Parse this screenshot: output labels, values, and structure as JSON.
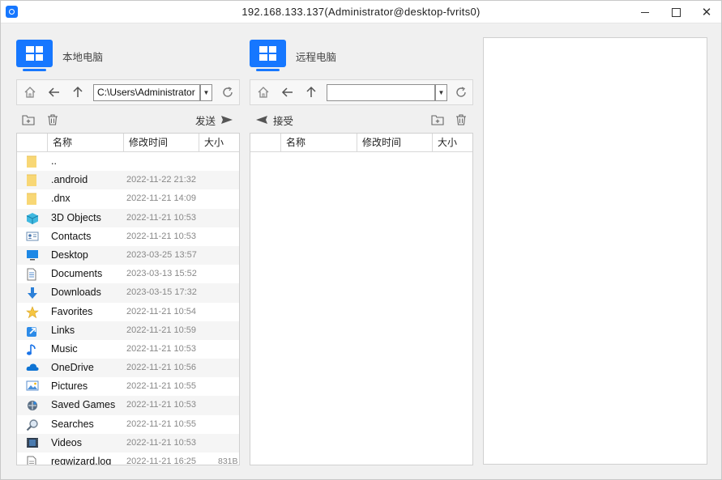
{
  "window": {
    "title": "192.168.133.137(Administrator@desktop-fvrits0)"
  },
  "local": {
    "label": "本地电脑",
    "path": "C:\\Users\\Administrator",
    "send_label": "发送",
    "columns": [
      "名称",
      "修改时间",
      "大小"
    ],
    "files": [
      {
        "name": "..",
        "date": "",
        "size": "",
        "icon": "folder-icon"
      },
      {
        "name": ".android",
        "date": "2022-11-22 21:32",
        "size": "",
        "icon": "folder-icon"
      },
      {
        "name": ".dnx",
        "date": "2022-11-21 14:09",
        "size": "",
        "icon": "folder-icon"
      },
      {
        "name": "3D Objects",
        "date": "2022-11-21 10:53",
        "size": "",
        "icon": "3d-objects-icon"
      },
      {
        "name": "Contacts",
        "date": "2022-11-21 10:53",
        "size": "",
        "icon": "contacts-icon"
      },
      {
        "name": "Desktop",
        "date": "2023-03-25 13:57",
        "size": "",
        "icon": "desktop-icon"
      },
      {
        "name": "Documents",
        "date": "2023-03-13 15:52",
        "size": "",
        "icon": "documents-icon"
      },
      {
        "name": "Downloads",
        "date": "2023-03-15 17:32",
        "size": "",
        "icon": "downloads-icon"
      },
      {
        "name": "Favorites",
        "date": "2022-11-21 10:54",
        "size": "",
        "icon": "favorites-icon"
      },
      {
        "name": "Links",
        "date": "2022-11-21 10:59",
        "size": "",
        "icon": "links-icon"
      },
      {
        "name": "Music",
        "date": "2022-11-21 10:53",
        "size": "",
        "icon": "music-icon"
      },
      {
        "name": "OneDrive",
        "date": "2022-11-21 10:56",
        "size": "",
        "icon": "onedrive-icon"
      },
      {
        "name": "Pictures",
        "date": "2022-11-21 10:55",
        "size": "",
        "icon": "pictures-icon"
      },
      {
        "name": "Saved Games",
        "date": "2022-11-21 10:53",
        "size": "",
        "icon": "saved-games-icon"
      },
      {
        "name": "Searches",
        "date": "2022-11-21 10:55",
        "size": "",
        "icon": "searches-icon"
      },
      {
        "name": "Videos",
        "date": "2022-11-21 10:53",
        "size": "",
        "icon": "videos-icon"
      },
      {
        "name": "regwizard.log",
        "date": "2022-11-21 16:25",
        "size": "831B",
        "icon": "file-icon"
      }
    ]
  },
  "remote": {
    "label": "远程电脑",
    "path": "",
    "receive_label": "接受",
    "columns": [
      "名称",
      "修改时间",
      "大小"
    ]
  },
  "colors": {
    "accent": "#1677ff",
    "folder": "#f8d775"
  }
}
